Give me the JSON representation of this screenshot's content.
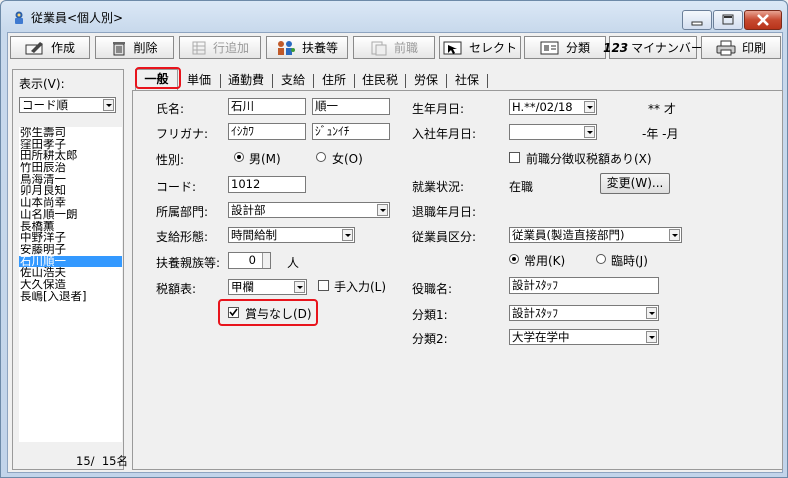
{
  "window": {
    "title": "従業員<個人別>"
  },
  "toolbar": {
    "create": "作成",
    "delete": "削除",
    "add_row": "行追加",
    "dependents": "扶養等",
    "prev": "前職",
    "select": "セレクト",
    "category": "分類",
    "mynumber": "マイナンバー",
    "print": "印刷",
    "mynumber_glyph": "123"
  },
  "left": {
    "display_label": "表示(V):",
    "sort_value": "コード順",
    "employees": [
      "弥生壽司",
      "窪田孝子",
      "田所耕太郎",
      "竹田辰治",
      "鳥海清一",
      "卯月良知",
      "山本尚幸",
      "山名順一朗",
      "長橋薫",
      "中野洋子",
      "安藤明子",
      "石川順一",
      "佐山浩夫",
      "大久保造",
      "長嶋[入退者]"
    ],
    "selected_index": 11,
    "count": "15/  15名"
  },
  "tabs": [
    "一般",
    "単価",
    "通勤費",
    "支給",
    "住所",
    "住民税",
    "労保",
    "社保"
  ],
  "form": {
    "name_label": "氏名:",
    "last_name": "石川",
    "first_name": "順一",
    "kana_label": "フリガナ:",
    "last_kana": "ｲｼｶﾜ",
    "first_kana": "ｼﾞｭﾝｲﾁ",
    "sex_label": "性別:",
    "male": "男(M)",
    "female": "女(O)",
    "code_label": "コード:",
    "code": "1012",
    "dept_label": "所属部門:",
    "dept": "設計部",
    "pay_label": "支給形態:",
    "pay": "時間給制",
    "dependents_label": "扶養親族等:",
    "dependents_value": "0",
    "dependents_unit": "人",
    "tax_label": "税額表:",
    "tax_table": "甲欄",
    "manual_input": "手入力(L)",
    "no_bonus": "賞与なし(D)",
    "birth_label": "生年月日:",
    "birth": "H.**/02/18",
    "age": "** 才",
    "join_label": "入社年月日:",
    "join": "",
    "tenure": "-年 -月",
    "prev_tax": "前職分徴収税額あり(X)",
    "status_label": "就業状況:",
    "status": "在職",
    "change_button": "変更(W)...",
    "retire_label": "退職年月日:",
    "emp_class_label": "従業員区分:",
    "emp_class": "従業員(製造直接部門)",
    "regular": "常用(K)",
    "temp": "臨時(J)",
    "title_label": "役職名:",
    "title": "設計ｽﾀｯﾌ",
    "class1_label": "分類1:",
    "class1": "設計ｽﾀｯﾌ",
    "class2_label": "分類2:",
    "class2": "大学在学中"
  },
  "colors": {
    "highlight": "#e8141c",
    "selection": "#3399ff"
  }
}
